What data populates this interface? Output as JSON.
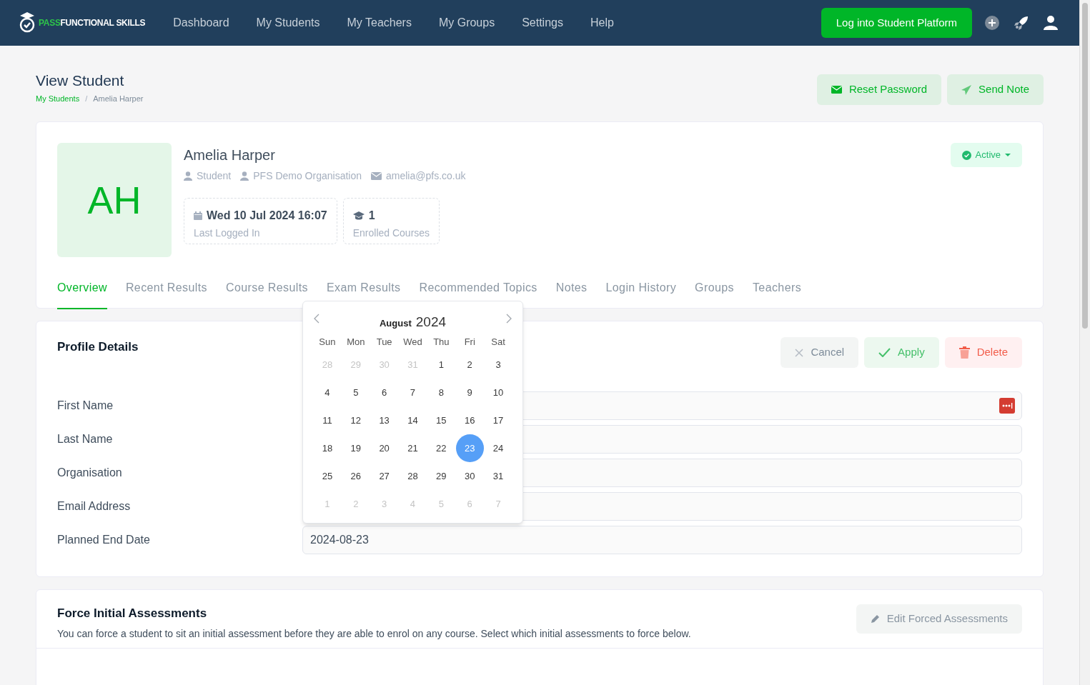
{
  "nav": {
    "logo": {
      "first": "PASS",
      "second": "FUNCTIONAL SKILLS"
    },
    "items": [
      {
        "label": "Dashboard"
      },
      {
        "label": "My Students"
      },
      {
        "label": "My Teachers"
      },
      {
        "label": "My Groups"
      },
      {
        "label": "Settings"
      },
      {
        "label": "Help"
      }
    ],
    "cta": "Log into Student Platform"
  },
  "page": {
    "title": "View Student",
    "breadcrumb": [
      {
        "label": "My Students",
        "link": true
      },
      {
        "label": "Amelia Harper",
        "link": false
      }
    ],
    "breadcrumb_separator": "/",
    "actions": [
      {
        "kind": "mail",
        "label": "Reset Password"
      },
      {
        "kind": "send",
        "label": "Send Note"
      }
    ]
  },
  "student": {
    "initials": "AH",
    "name": "Amelia Harper",
    "status": "Active",
    "meta": [
      {
        "kind": "user",
        "text": "Student"
      },
      {
        "kind": "user",
        "text": "PFS Demo Organisation"
      },
      {
        "kind": "mail",
        "text": "amelia@pfs.co.uk"
      }
    ],
    "stats": [
      {
        "kind": "calendar",
        "value": "Wed 10 Jul 2024 16:07",
        "label": "Last Logged In"
      },
      {
        "kind": "cap",
        "value": "1",
        "label": "Enrolled Courses"
      }
    ]
  },
  "tabs": [
    {
      "label": "Overview",
      "selected": true
    },
    {
      "label": "Recent Results",
      "selected": false
    },
    {
      "label": "Course Results",
      "selected": false
    },
    {
      "label": "Exam Results",
      "selected": false
    },
    {
      "label": "Recommended Topics",
      "selected": false
    },
    {
      "label": "Notes",
      "selected": false
    },
    {
      "label": "Login History",
      "selected": false
    },
    {
      "label": "Groups",
      "selected": false
    },
    {
      "label": "Teachers",
      "selected": false
    }
  ],
  "profile": {
    "title": "Profile Details",
    "buttons": [
      {
        "kind": "cancel",
        "label": "Cancel"
      },
      {
        "kind": "apply",
        "label": "Apply"
      },
      {
        "kind": "delete",
        "label": "Delete"
      }
    ],
    "fields": [
      {
        "label": "First Name",
        "password_manager": true
      },
      {
        "label": "Last Name",
        "password_manager": false
      },
      {
        "label": "Organisation",
        "password_manager": false
      },
      {
        "label": "Email Address",
        "password_manager": false
      },
      {
        "label": "Planned End Date",
        "value": "2024-08-23",
        "password_manager": false
      }
    ]
  },
  "datepicker": {
    "month": "August",
    "year": "2024",
    "weekdays": [
      "Sun",
      "Mon",
      "Tue",
      "Wed",
      "Thu",
      "Fri",
      "Sat"
    ],
    "days": [
      {
        "day": "28",
        "outside": true,
        "selected": false
      },
      {
        "day": "29",
        "outside": true,
        "selected": false
      },
      {
        "day": "30",
        "outside": true,
        "selected": false
      },
      {
        "day": "31",
        "outside": true,
        "selected": false
      },
      {
        "day": "1",
        "outside": false,
        "selected": false
      },
      {
        "day": "2",
        "outside": false,
        "selected": false
      },
      {
        "day": "3",
        "outside": false,
        "selected": false
      },
      {
        "day": "4",
        "outside": false,
        "selected": false
      },
      {
        "day": "5",
        "outside": false,
        "selected": false
      },
      {
        "day": "6",
        "outside": false,
        "selected": false
      },
      {
        "day": "7",
        "outside": false,
        "selected": false
      },
      {
        "day": "8",
        "outside": false,
        "selected": false
      },
      {
        "day": "9",
        "outside": false,
        "selected": false
      },
      {
        "day": "10",
        "outside": false,
        "selected": false
      },
      {
        "day": "11",
        "outside": false,
        "selected": false
      },
      {
        "day": "12",
        "outside": false,
        "selected": false
      },
      {
        "day": "13",
        "outside": false,
        "selected": false
      },
      {
        "day": "14",
        "outside": false,
        "selected": false
      },
      {
        "day": "15",
        "outside": false,
        "selected": false
      },
      {
        "day": "16",
        "outside": false,
        "selected": false
      },
      {
        "day": "17",
        "outside": false,
        "selected": false
      },
      {
        "day": "18",
        "outside": false,
        "selected": false
      },
      {
        "day": "19",
        "outside": false,
        "selected": false
      },
      {
        "day": "20",
        "outside": false,
        "selected": false
      },
      {
        "day": "21",
        "outside": false,
        "selected": false
      },
      {
        "day": "22",
        "outside": false,
        "selected": false
      },
      {
        "day": "23",
        "outside": false,
        "selected": true
      },
      {
        "day": "24",
        "outside": false,
        "selected": false
      },
      {
        "day": "25",
        "outside": false,
        "selected": false
      },
      {
        "day": "26",
        "outside": false,
        "selected": false
      },
      {
        "day": "27",
        "outside": false,
        "selected": false
      },
      {
        "day": "28",
        "outside": false,
        "selected": false
      },
      {
        "day": "29",
        "outside": false,
        "selected": false
      },
      {
        "day": "30",
        "outside": false,
        "selected": false
      },
      {
        "day": "31",
        "outside": false,
        "selected": false
      },
      {
        "day": "1",
        "outside": true,
        "selected": false
      },
      {
        "day": "2",
        "outside": true,
        "selected": false
      },
      {
        "day": "3",
        "outside": true,
        "selected": false
      },
      {
        "day": "4",
        "outside": true,
        "selected": false
      },
      {
        "day": "5",
        "outside": true,
        "selected": false
      },
      {
        "day": "6",
        "outside": true,
        "selected": false
      },
      {
        "day": "7",
        "outside": true,
        "selected": false
      }
    ]
  },
  "force": {
    "title": "Force Initial Assessments",
    "description": "You can force a student to sit an initial assessment before they are able to enrol on any course. Select which initial assessments to force below.",
    "button": "Edit Forced Assessments"
  }
}
